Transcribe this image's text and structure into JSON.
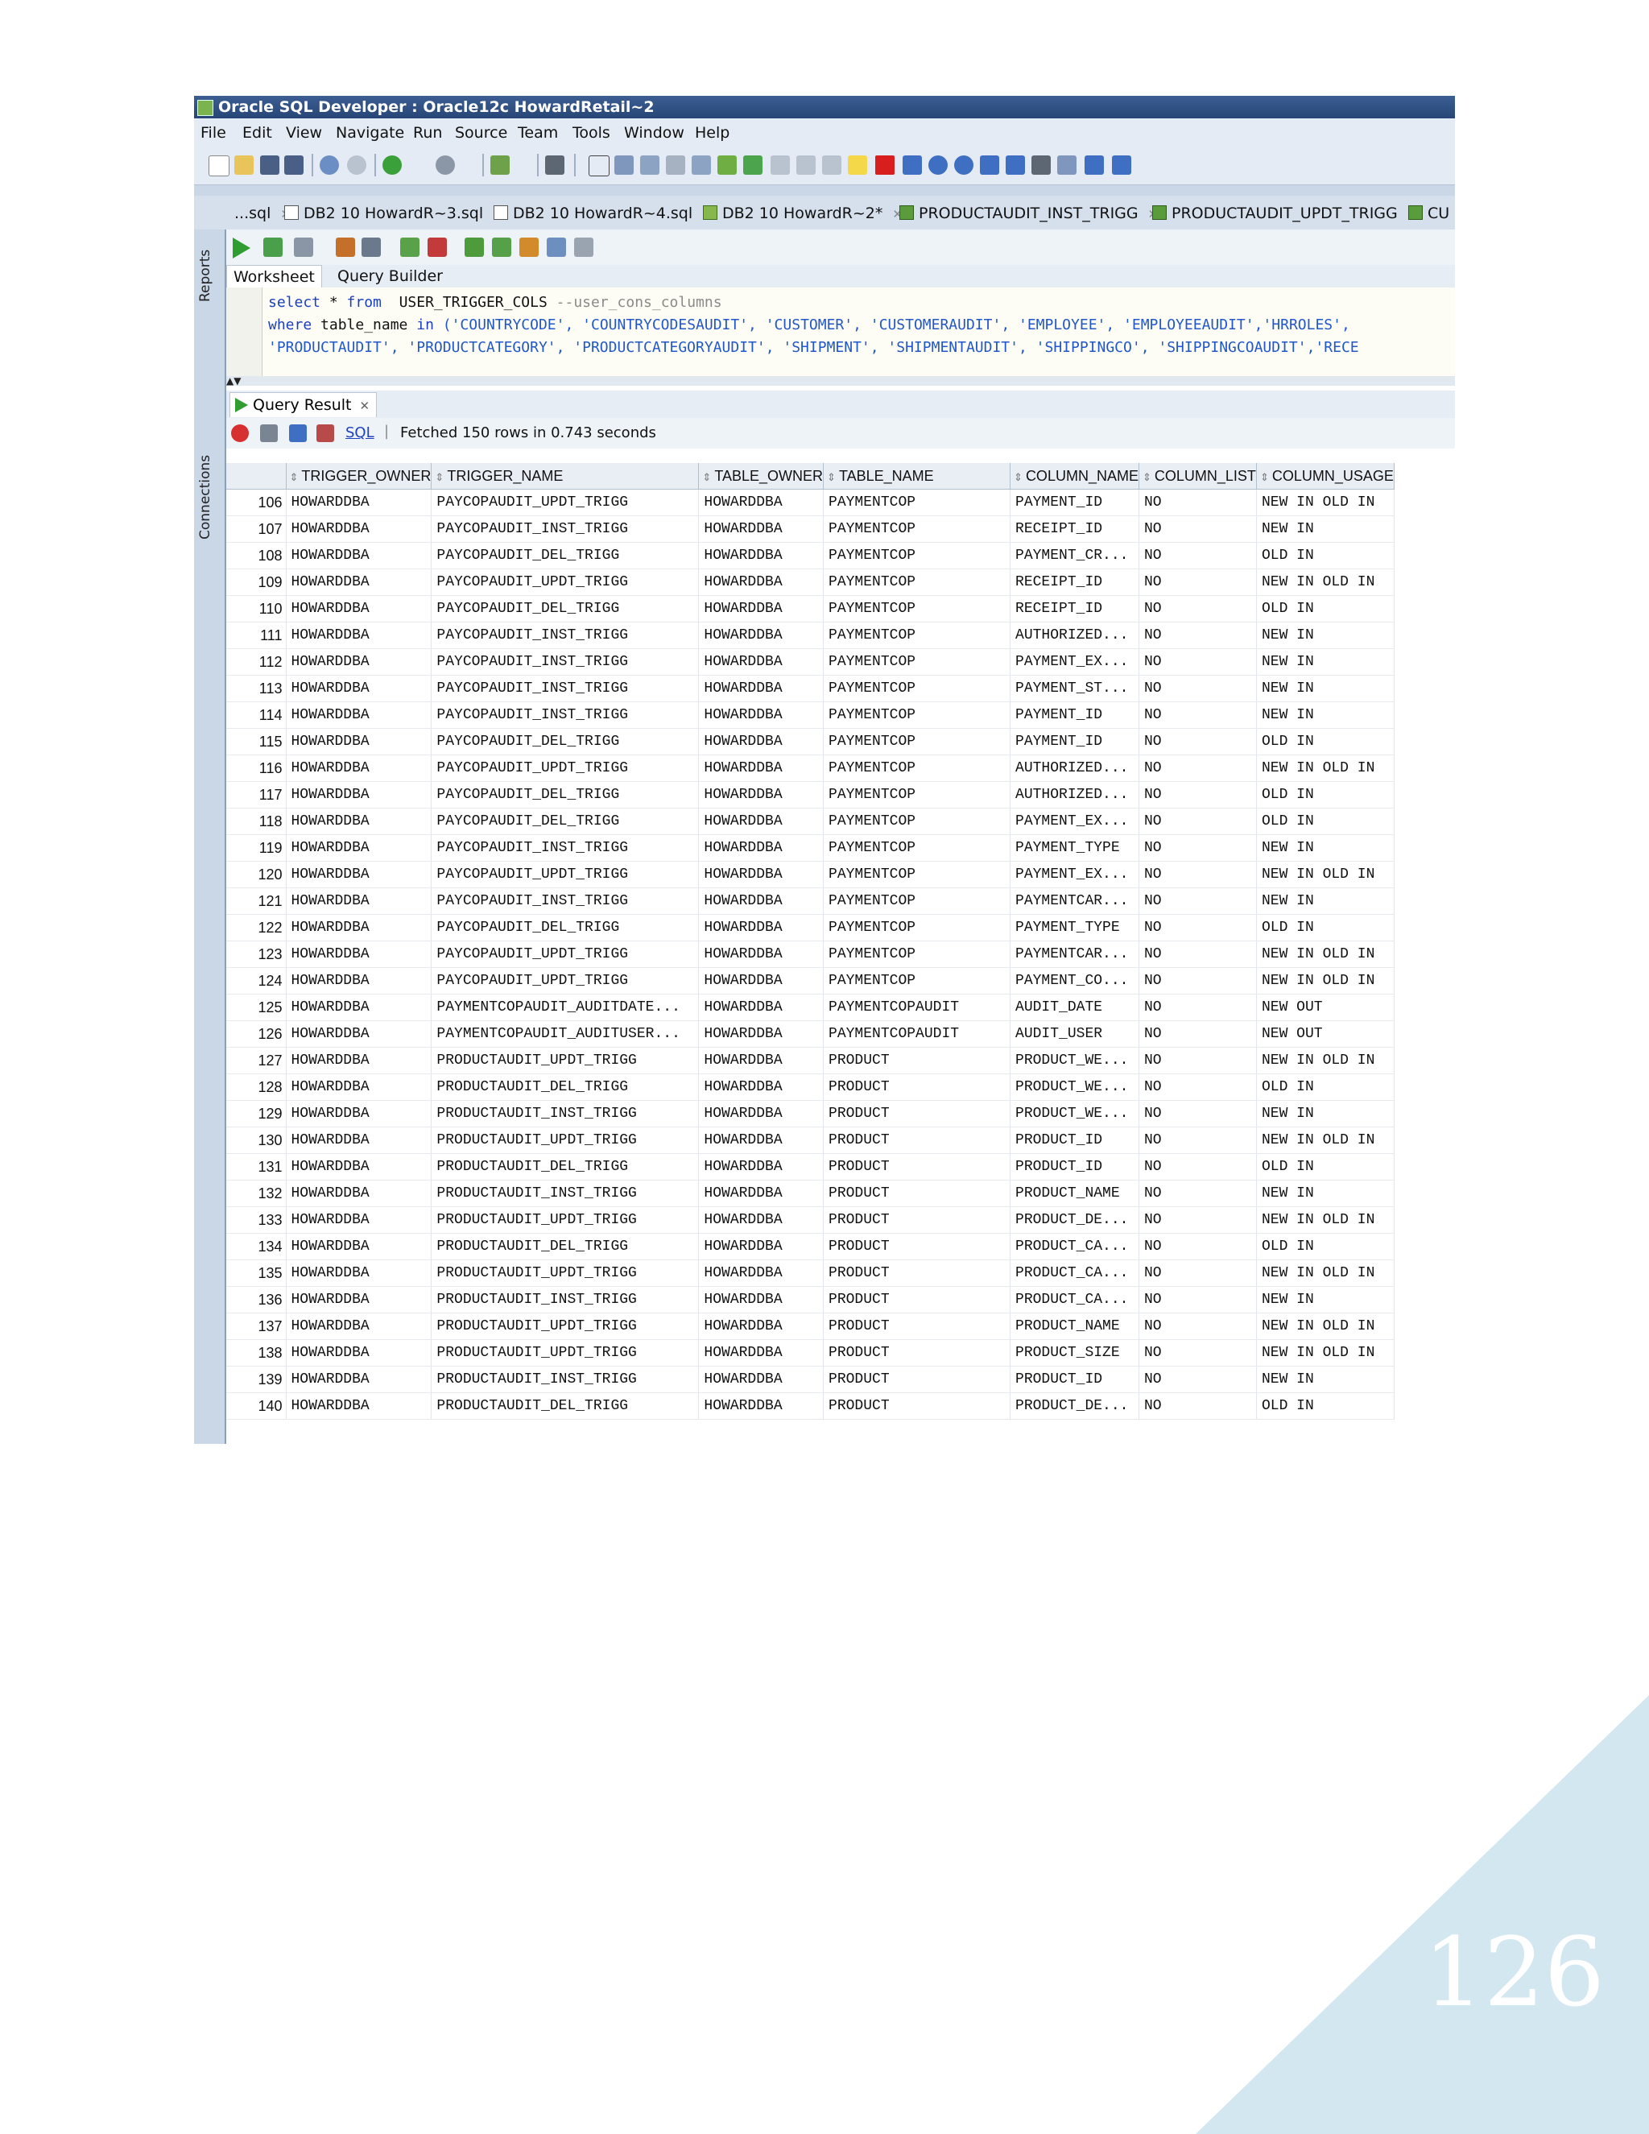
{
  "window": {
    "title": "Oracle SQL Developer : Oracle12c HowardRetail~2"
  },
  "menu": [
    "File",
    "Edit",
    "View",
    "Navigate",
    "Run",
    "Source",
    "Team",
    "Tools",
    "Window",
    "Help"
  ],
  "doc_tabs": [
    {
      "label": "...sql",
      "icon": "sql-file-icon"
    },
    {
      "label": "DB2 10 HowardR~3.sql",
      "icon": "sql-file-icon"
    },
    {
      "label": "DB2 10 HowardR~4.sql",
      "icon": "sql-file-icon"
    },
    {
      "label": "DB2 10 HowardR~2*",
      "icon": "sql-worksheet-icon"
    },
    {
      "label": "PRODUCTAUDIT_INST_TRIGG",
      "icon": "trigger-icon"
    },
    {
      "label": "PRODUCTAUDIT_UPDT_TRIGG",
      "icon": "trigger-icon"
    },
    {
      "label": "CU",
      "icon": "trigger-icon"
    }
  ],
  "side_labels": {
    "reports": "Reports",
    "connections": "Connections"
  },
  "worksheet_tabs": {
    "worksheet": "Worksheet",
    "query_builder": "Query Builder"
  },
  "editor": {
    "line1": {
      "kw1": "select",
      "star": " * ",
      "kw2": "from",
      "obj": "  USER_TRIGGER_COLS ",
      "comment": "--user_cons_columns"
    },
    "line2": {
      "kw1": "where",
      "plain": " table_name ",
      "kw2": "in",
      "list": " ('COUNTRYCODE', 'COUNTRYCODESAUDIT', 'CUSTOMER', 'CUSTOMERAUDIT', 'EMPLOYEE', 'EMPLOYEEAUDIT','HRROLES',"
    },
    "line3": {
      "list": "'PRODUCTAUDIT', 'PRODUCTCATEGORY', 'PRODUCTCATEGORYAUDIT', 'SHIPMENT', 'SHIPMENTAUDIT', 'SHIPPINGCO', 'SHIPPINGCOAUDIT','RECE"
    }
  },
  "result": {
    "tab_label": "Query Result",
    "sql_link": "SQL",
    "status": "Fetched 150 rows in 0.743 seconds"
  },
  "columns": [
    "TRIGGER_OWNER",
    "TRIGGER_NAME",
    "TABLE_OWNER",
    "TABLE_NAME",
    "COLUMN_NAME",
    "COLUMN_LIST",
    "COLUMN_USAGE"
  ],
  "rows": [
    [
      "106",
      "HOWARDDBA",
      "PAYCOPAUDIT_UPDT_TRIGG",
      "HOWARDDBA",
      "PAYMENTCOP",
      "PAYMENT_ID",
      "NO",
      "NEW IN OLD IN"
    ],
    [
      "107",
      "HOWARDDBA",
      "PAYCOPAUDIT_INST_TRIGG",
      "HOWARDDBA",
      "PAYMENTCOP",
      "RECEIPT_ID",
      "NO",
      "NEW IN"
    ],
    [
      "108",
      "HOWARDDBA",
      "PAYCOPAUDIT_DEL_TRIGG",
      "HOWARDDBA",
      "PAYMENTCOP",
      "PAYMENT_CR...",
      "NO",
      "OLD IN"
    ],
    [
      "109",
      "HOWARDDBA",
      "PAYCOPAUDIT_UPDT_TRIGG",
      "HOWARDDBA",
      "PAYMENTCOP",
      "RECEIPT_ID",
      "NO",
      "NEW IN OLD IN"
    ],
    [
      "110",
      "HOWARDDBA",
      "PAYCOPAUDIT_DEL_TRIGG",
      "HOWARDDBA",
      "PAYMENTCOP",
      "RECEIPT_ID",
      "NO",
      "OLD IN"
    ],
    [
      "111",
      "HOWARDDBA",
      "PAYCOPAUDIT_INST_TRIGG",
      "HOWARDDBA",
      "PAYMENTCOP",
      "AUTHORIZED...",
      "NO",
      "NEW IN"
    ],
    [
      "112",
      "HOWARDDBA",
      "PAYCOPAUDIT_INST_TRIGG",
      "HOWARDDBA",
      "PAYMENTCOP",
      "PAYMENT_EX...",
      "NO",
      "NEW IN"
    ],
    [
      "113",
      "HOWARDDBA",
      "PAYCOPAUDIT_INST_TRIGG",
      "HOWARDDBA",
      "PAYMENTCOP",
      "PAYMENT_ST...",
      "NO",
      "NEW IN"
    ],
    [
      "114",
      "HOWARDDBA",
      "PAYCOPAUDIT_INST_TRIGG",
      "HOWARDDBA",
      "PAYMENTCOP",
      "PAYMENT_ID",
      "NO",
      "NEW IN"
    ],
    [
      "115",
      "HOWARDDBA",
      "PAYCOPAUDIT_DEL_TRIGG",
      "HOWARDDBA",
      "PAYMENTCOP",
      "PAYMENT_ID",
      "NO",
      "OLD IN"
    ],
    [
      "116",
      "HOWARDDBA",
      "PAYCOPAUDIT_UPDT_TRIGG",
      "HOWARDDBA",
      "PAYMENTCOP",
      "AUTHORIZED...",
      "NO",
      "NEW IN OLD IN"
    ],
    [
      "117",
      "HOWARDDBA",
      "PAYCOPAUDIT_DEL_TRIGG",
      "HOWARDDBA",
      "PAYMENTCOP",
      "AUTHORIZED...",
      "NO",
      "OLD IN"
    ],
    [
      "118",
      "HOWARDDBA",
      "PAYCOPAUDIT_DEL_TRIGG",
      "HOWARDDBA",
      "PAYMENTCOP",
      "PAYMENT_EX...",
      "NO",
      "OLD IN"
    ],
    [
      "119",
      "HOWARDDBA",
      "PAYCOPAUDIT_INST_TRIGG",
      "HOWARDDBA",
      "PAYMENTCOP",
      "PAYMENT_TYPE",
      "NO",
      "NEW IN"
    ],
    [
      "120",
      "HOWARDDBA",
      "PAYCOPAUDIT_UPDT_TRIGG",
      "HOWARDDBA",
      "PAYMENTCOP",
      "PAYMENT_EX...",
      "NO",
      "NEW IN OLD IN"
    ],
    [
      "121",
      "HOWARDDBA",
      "PAYCOPAUDIT_INST_TRIGG",
      "HOWARDDBA",
      "PAYMENTCOP",
      "PAYMENTCAR...",
      "NO",
      "NEW IN"
    ],
    [
      "122",
      "HOWARDDBA",
      "PAYCOPAUDIT_DEL_TRIGG",
      "HOWARDDBA",
      "PAYMENTCOP",
      "PAYMENT_TYPE",
      "NO",
      "OLD IN"
    ],
    [
      "123",
      "HOWARDDBA",
      "PAYCOPAUDIT_UPDT_TRIGG",
      "HOWARDDBA",
      "PAYMENTCOP",
      "PAYMENTCAR...",
      "NO",
      "NEW IN OLD IN"
    ],
    [
      "124",
      "HOWARDDBA",
      "PAYCOPAUDIT_UPDT_TRIGG",
      "HOWARDDBA",
      "PAYMENTCOP",
      "PAYMENT_CO...",
      "NO",
      "NEW IN OLD IN"
    ],
    [
      "125",
      "HOWARDDBA",
      "PAYMENTCOPAUDIT_AUDITDATE...",
      "HOWARDDBA",
      "PAYMENTCOPAUDIT",
      "AUDIT_DATE",
      "NO",
      "NEW OUT"
    ],
    [
      "126",
      "HOWARDDBA",
      "PAYMENTCOPAUDIT_AUDITUSER...",
      "HOWARDDBA",
      "PAYMENTCOPAUDIT",
      "AUDIT_USER",
      "NO",
      "NEW OUT"
    ],
    [
      "127",
      "HOWARDDBA",
      "PRODUCTAUDIT_UPDT_TRIGG",
      "HOWARDDBA",
      "PRODUCT",
      "PRODUCT_WE...",
      "NO",
      "NEW IN OLD IN"
    ],
    [
      "128",
      "HOWARDDBA",
      "PRODUCTAUDIT_DEL_TRIGG",
      "HOWARDDBA",
      "PRODUCT",
      "PRODUCT_WE...",
      "NO",
      "OLD IN"
    ],
    [
      "129",
      "HOWARDDBA",
      "PRODUCTAUDIT_INST_TRIGG",
      "HOWARDDBA",
      "PRODUCT",
      "PRODUCT_WE...",
      "NO",
      "NEW IN"
    ],
    [
      "130",
      "HOWARDDBA",
      "PRODUCTAUDIT_UPDT_TRIGG",
      "HOWARDDBA",
      "PRODUCT",
      "PRODUCT_ID",
      "NO",
      "NEW IN OLD IN"
    ],
    [
      "131",
      "HOWARDDBA",
      "PRODUCTAUDIT_DEL_TRIGG",
      "HOWARDDBA",
      "PRODUCT",
      "PRODUCT_ID",
      "NO",
      "OLD IN"
    ],
    [
      "132",
      "HOWARDDBA",
      "PRODUCTAUDIT_INST_TRIGG",
      "HOWARDDBA",
      "PRODUCT",
      "PRODUCT_NAME",
      "NO",
      "NEW IN"
    ],
    [
      "133",
      "HOWARDDBA",
      "PRODUCTAUDIT_UPDT_TRIGG",
      "HOWARDDBA",
      "PRODUCT",
      "PRODUCT_DE...",
      "NO",
      "NEW IN OLD IN"
    ],
    [
      "134",
      "HOWARDDBA",
      "PRODUCTAUDIT_DEL_TRIGG",
      "HOWARDDBA",
      "PRODUCT",
      "PRODUCT_CA...",
      "NO",
      "OLD IN"
    ],
    [
      "135",
      "HOWARDDBA",
      "PRODUCTAUDIT_UPDT_TRIGG",
      "HOWARDDBA",
      "PRODUCT",
      "PRODUCT_CA...",
      "NO",
      "NEW IN OLD IN"
    ],
    [
      "136",
      "HOWARDDBA",
      "PRODUCTAUDIT_INST_TRIGG",
      "HOWARDDBA",
      "PRODUCT",
      "PRODUCT_CA...",
      "NO",
      "NEW IN"
    ],
    [
      "137",
      "HOWARDDBA",
      "PRODUCTAUDIT_UPDT_TRIGG",
      "HOWARDDBA",
      "PRODUCT",
      "PRODUCT_NAME",
      "NO",
      "NEW IN OLD IN"
    ],
    [
      "138",
      "HOWARDDBA",
      "PRODUCTAUDIT_UPDT_TRIGG",
      "HOWARDDBA",
      "PRODUCT",
      "PRODUCT_SIZE",
      "NO",
      "NEW IN OLD IN"
    ],
    [
      "139",
      "HOWARDDBA",
      "PRODUCTAUDIT_INST_TRIGG",
      "HOWARDDBA",
      "PRODUCT",
      "PRODUCT_ID",
      "NO",
      "NEW IN"
    ],
    [
      "140",
      "HOWARDDBA",
      "PRODUCTAUDIT_DEL_TRIGG",
      "HOWARDDBA",
      "PRODUCT",
      "PRODUCT_DE...",
      "NO",
      "OLD IN"
    ]
  ],
  "page": {
    "number": "126"
  },
  "colors": {
    "corner_triangle": "#d2e7ef",
    "active_tab_underline": "#8e1d33",
    "titlebar": "#2f4f82"
  }
}
